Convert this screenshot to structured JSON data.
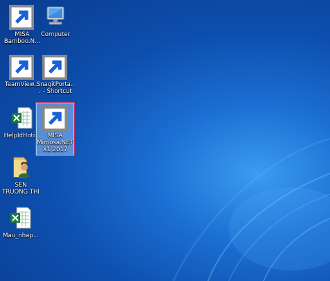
{
  "desktop": {
    "icons": [
      {
        "label": "MISA Bamboo.N...",
        "icon": "misa-bamboo-icon",
        "selected": false
      },
      {
        "label": "Computer",
        "icon": "computer-icon",
        "selected": false
      },
      {
        "label": "TeamView...",
        "icon": "teamviewer-icon",
        "selected": false
      },
      {
        "label": "SnagitPorta... - Shortcut",
        "icon": "snagit-icon",
        "selected": false
      },
      {
        "label": "HelpIdHoti...",
        "icon": "excel-icon",
        "selected": false
      },
      {
        "label": "MISA Mimosa.NET X1 2017",
        "icon": "misa-mimosa-icon",
        "selected": true
      },
      {
        "label": "SEN TRUONG THI",
        "icon": "user-folder-icon",
        "selected": false
      },
      {
        "label": "Mau_nhap...",
        "icon": "excel-icon",
        "selected": false
      }
    ]
  },
  "colors": {
    "wallpaper_dark": "#0a3b8f",
    "wallpaper_light": "#3a9cf0",
    "selection_border": "#b8316a"
  }
}
